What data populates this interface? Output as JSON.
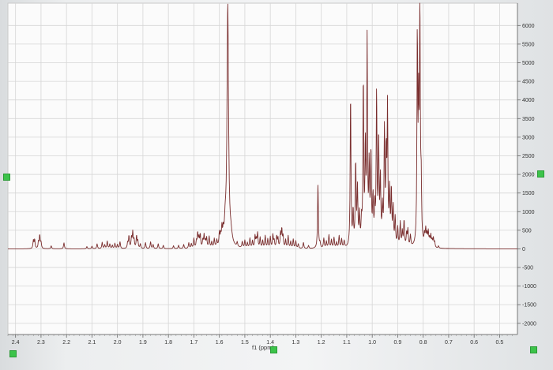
{
  "chart_data": {
    "type": "line",
    "title": "",
    "xlabel": "f1 (ppm)",
    "ylabel": "",
    "xlim": [
      2.43,
      0.43
    ],
    "xreversed": true,
    "ylim": [
      -2300,
      6600
    ],
    "xticks": [
      2.4,
      2.3,
      2.2,
      2.1,
      2.0,
      1.9,
      1.8,
      1.7,
      1.6,
      1.5,
      1.4,
      1.3,
      1.2,
      1.1,
      1.0,
      0.9,
      0.8,
      0.7,
      0.6,
      0.5
    ],
    "xtick_labels": [
      "2.4",
      "2.3",
      "2.2",
      "2.1",
      "2.0",
      "1.9",
      "1.8",
      "1.7",
      "1.6",
      "1.5",
      "1.4",
      "1.3",
      "1.2",
      "1.1",
      "1.0",
      "0.9",
      "0.8",
      "0.7",
      "0.6",
      "0.5"
    ],
    "yticks": [
      6000,
      5500,
      5000,
      4500,
      4000,
      3500,
      3000,
      2500,
      2000,
      1500,
      1000,
      500,
      0,
      -500,
      -1000,
      -1500,
      -2000
    ],
    "ytick_labels": [
      "6000",
      "5500",
      "5000",
      "4500",
      "4000",
      "3500",
      "3000",
      "2500",
      "2000",
      "1500",
      "1000",
      "500",
      "0",
      "-500",
      "-1000",
      "-1500",
      "-2000"
    ],
    "grid": true,
    "baseline": 0,
    "series": [
      {
        "color": "#7a2e2e",
        "peaks": [
          {
            "x": 2.33,
            "y": 220,
            "w": 0.002
          },
          {
            "x": 2.325,
            "y": 240,
            "w": 0.002
          },
          {
            "x": 2.31,
            "y": 170,
            "w": 0.002
          },
          {
            "x": 2.305,
            "y": 350,
            "w": 0.002
          },
          {
            "x": 2.3,
            "y": 160,
            "w": 0.002
          },
          {
            "x": 2.26,
            "y": 80,
            "w": 0.002
          },
          {
            "x": 2.21,
            "y": 160,
            "w": 0.002
          },
          {
            "x": 2.12,
            "y": 60,
            "w": 0.002
          },
          {
            "x": 2.1,
            "y": 70,
            "w": 0.002
          },
          {
            "x": 2.08,
            "y": 130,
            "w": 0.002
          },
          {
            "x": 2.06,
            "y": 170,
            "w": 0.002
          },
          {
            "x": 2.05,
            "y": 100,
            "w": 0.002
          },
          {
            "x": 2.04,
            "y": 200,
            "w": 0.002
          },
          {
            "x": 2.03,
            "y": 120,
            "w": 0.002
          },
          {
            "x": 2.02,
            "y": 90,
            "w": 0.002
          },
          {
            "x": 2.01,
            "y": 140,
            "w": 0.002
          },
          {
            "x": 2.0,
            "y": 110,
            "w": 0.002
          },
          {
            "x": 1.99,
            "y": 180,
            "w": 0.002
          },
          {
            "x": 1.96,
            "y": 150,
            "w": 0.002
          },
          {
            "x": 1.955,
            "y": 330,
            "w": 0.002
          },
          {
            "x": 1.945,
            "y": 280,
            "w": 0.002
          },
          {
            "x": 1.94,
            "y": 420,
            "w": 0.002
          },
          {
            "x": 1.935,
            "y": 220,
            "w": 0.002
          },
          {
            "x": 1.925,
            "y": 330,
            "w": 0.002
          },
          {
            "x": 1.92,
            "y": 190,
            "w": 0.002
          },
          {
            "x": 1.91,
            "y": 120,
            "w": 0.002
          },
          {
            "x": 1.89,
            "y": 160,
            "w": 0.002
          },
          {
            "x": 1.87,
            "y": 180,
            "w": 0.002
          },
          {
            "x": 1.86,
            "y": 110,
            "w": 0.002
          },
          {
            "x": 1.84,
            "y": 130,
            "w": 0.002
          },
          {
            "x": 1.82,
            "y": 90,
            "w": 0.002
          },
          {
            "x": 1.78,
            "y": 80,
            "w": 0.002
          },
          {
            "x": 1.76,
            "y": 90,
            "w": 0.002
          },
          {
            "x": 1.74,
            "y": 110,
            "w": 0.002
          },
          {
            "x": 1.72,
            "y": 150,
            "w": 0.002
          },
          {
            "x": 1.71,
            "y": 120,
            "w": 0.002
          },
          {
            "x": 1.7,
            "y": 260,
            "w": 0.002
          },
          {
            "x": 1.69,
            "y": 180,
            "w": 0.002
          },
          {
            "x": 1.685,
            "y": 390,
            "w": 0.002
          },
          {
            "x": 1.68,
            "y": 250,
            "w": 0.002
          },
          {
            "x": 1.675,
            "y": 350,
            "w": 0.002
          },
          {
            "x": 1.665,
            "y": 200,
            "w": 0.002
          },
          {
            "x": 1.66,
            "y": 330,
            "w": 0.002
          },
          {
            "x": 1.655,
            "y": 170,
            "w": 0.002
          },
          {
            "x": 1.65,
            "y": 260,
            "w": 0.002
          },
          {
            "x": 1.64,
            "y": 300,
            "w": 0.002
          },
          {
            "x": 1.63,
            "y": 150,
            "w": 0.002
          },
          {
            "x": 1.62,
            "y": 230,
            "w": 0.002
          },
          {
            "x": 1.61,
            "y": 180,
            "w": 0.002
          },
          {
            "x": 1.6,
            "y": 340,
            "w": 0.002
          },
          {
            "x": 1.595,
            "y": 250,
            "w": 0.002
          },
          {
            "x": 1.59,
            "y": 420,
            "w": 0.002
          },
          {
            "x": 1.585,
            "y": 300,
            "w": 0.002
          },
          {
            "x": 1.577,
            "y": 500,
            "w": 0.004
          },
          {
            "x": 1.567,
            "y": 6500,
            "w": 0.0035
          },
          {
            "x": 1.555,
            "y": 260,
            "w": 0.006
          },
          {
            "x": 1.53,
            "y": 120,
            "w": 0.002
          },
          {
            "x": 1.51,
            "y": 160,
            "w": 0.002
          },
          {
            "x": 1.5,
            "y": 200,
            "w": 0.002
          },
          {
            "x": 1.49,
            "y": 140,
            "w": 0.002
          },
          {
            "x": 1.48,
            "y": 260,
            "w": 0.002
          },
          {
            "x": 1.47,
            "y": 190,
            "w": 0.002
          },
          {
            "x": 1.46,
            "y": 320,
            "w": 0.002
          },
          {
            "x": 1.455,
            "y": 220,
            "w": 0.002
          },
          {
            "x": 1.45,
            "y": 390,
            "w": 0.002
          },
          {
            "x": 1.44,
            "y": 280,
            "w": 0.002
          },
          {
            "x": 1.43,
            "y": 200,
            "w": 0.002
          },
          {
            "x": 1.42,
            "y": 330,
            "w": 0.002
          },
          {
            "x": 1.41,
            "y": 240,
            "w": 0.002
          },
          {
            "x": 1.4,
            "y": 300,
            "w": 0.002
          },
          {
            "x": 1.39,
            "y": 350,
            "w": 0.002
          },
          {
            "x": 1.385,
            "y": 200,
            "w": 0.002
          },
          {
            "x": 1.375,
            "y": 310,
            "w": 0.002
          },
          {
            "x": 1.37,
            "y": 250,
            "w": 0.002
          },
          {
            "x": 1.36,
            "y": 380,
            "w": 0.002
          },
          {
            "x": 1.355,
            "y": 480,
            "w": 0.002
          },
          {
            "x": 1.35,
            "y": 300,
            "w": 0.002
          },
          {
            "x": 1.34,
            "y": 220,
            "w": 0.002
          },
          {
            "x": 1.33,
            "y": 330,
            "w": 0.002
          },
          {
            "x": 1.32,
            "y": 180,
            "w": 0.002
          },
          {
            "x": 1.31,
            "y": 240,
            "w": 0.002
          },
          {
            "x": 1.3,
            "y": 200,
            "w": 0.002
          },
          {
            "x": 1.29,
            "y": 120,
            "w": 0.002
          },
          {
            "x": 1.27,
            "y": 160,
            "w": 0.002
          },
          {
            "x": 1.25,
            "y": 80,
            "w": 0.002
          },
          {
            "x": 1.213,
            "y": 1750,
            "w": 0.0018
          },
          {
            "x": 1.205,
            "y": 130,
            "w": 0.002
          },
          {
            "x": 1.19,
            "y": 260,
            "w": 0.002
          },
          {
            "x": 1.18,
            "y": 180,
            "w": 0.002
          },
          {
            "x": 1.17,
            "y": 350,
            "w": 0.002
          },
          {
            "x": 1.16,
            "y": 220,
            "w": 0.002
          },
          {
            "x": 1.15,
            "y": 280,
            "w": 0.002
          },
          {
            "x": 1.14,
            "y": 150,
            "w": 0.002
          },
          {
            "x": 1.13,
            "y": 320,
            "w": 0.002
          },
          {
            "x": 1.12,
            "y": 230,
            "w": 0.002
          },
          {
            "x": 1.11,
            "y": 180,
            "w": 0.002
          },
          {
            "x": 1.085,
            "y": 4150,
            "w": 0.0018
          },
          {
            "x": 1.075,
            "y": 900,
            "w": 0.002
          },
          {
            "x": 1.065,
            "y": 2200,
            "w": 0.002
          },
          {
            "x": 1.058,
            "y": 1500,
            "w": 0.002
          },
          {
            "x": 1.05,
            "y": 800,
            "w": 0.002
          },
          {
            "x": 1.042,
            "y": 600,
            "w": 0.002
          },
          {
            "x": 1.035,
            "y": 4400,
            "w": 0.0018
          },
          {
            "x": 1.027,
            "y": 2500,
            "w": 0.002
          },
          {
            "x": 1.02,
            "y": 5400,
            "w": 0.0018
          },
          {
            "x": 1.012,
            "y": 2000,
            "w": 0.002
          },
          {
            "x": 1.005,
            "y": 2400,
            "w": 0.002
          },
          {
            "x": 0.997,
            "y": 1200,
            "w": 0.002
          },
          {
            "x": 0.99,
            "y": 900,
            "w": 0.002
          },
          {
            "x": 0.983,
            "y": 4050,
            "w": 0.0018
          },
          {
            "x": 0.975,
            "y": 2800,
            "w": 0.002
          },
          {
            "x": 0.968,
            "y": 1700,
            "w": 0.002
          },
          {
            "x": 0.96,
            "y": 900,
            "w": 0.002
          },
          {
            "x": 0.952,
            "y": 3050,
            "w": 0.002
          },
          {
            "x": 0.945,
            "y": 2300,
            "w": 0.002
          },
          {
            "x": 0.94,
            "y": 3550,
            "w": 0.0018
          },
          {
            "x": 0.932,
            "y": 1400,
            "w": 0.002
          },
          {
            "x": 0.925,
            "y": 1450,
            "w": 0.002
          },
          {
            "x": 0.918,
            "y": 1000,
            "w": 0.002
          },
          {
            "x": 0.91,
            "y": 750,
            "w": 0.002
          },
          {
            "x": 0.9,
            "y": 500,
            "w": 0.002
          },
          {
            "x": 0.89,
            "y": 650,
            "w": 0.002
          },
          {
            "x": 0.882,
            "y": 400,
            "w": 0.002
          },
          {
            "x": 0.875,
            "y": 700,
            "w": 0.002
          },
          {
            "x": 0.865,
            "y": 350,
            "w": 0.002
          },
          {
            "x": 0.86,
            "y": 450,
            "w": 0.002
          },
          {
            "x": 0.85,
            "y": 300,
            "w": 0.002
          },
          {
            "x": 0.823,
            "y": 5500,
            "w": 0.0018
          },
          {
            "x": 0.818,
            "y": 3300,
            "w": 0.0018
          },
          {
            "x": 0.813,
            "y": 6500,
            "w": 0.0018
          },
          {
            "x": 0.808,
            "y": 1500,
            "w": 0.002
          },
          {
            "x": 0.795,
            "y": 280,
            "w": 0.002
          },
          {
            "x": 0.79,
            "y": 420,
            "w": 0.002
          },
          {
            "x": 0.785,
            "y": 300,
            "w": 0.002
          },
          {
            "x": 0.78,
            "y": 380,
            "w": 0.002
          },
          {
            "x": 0.775,
            "y": 200,
            "w": 0.002
          },
          {
            "x": 0.77,
            "y": 300,
            "w": 0.002
          },
          {
            "x": 0.765,
            "y": 180,
            "w": 0.002
          },
          {
            "x": 0.76,
            "y": 240,
            "w": 0.002
          },
          {
            "x": 0.755,
            "y": 150,
            "w": 0.002
          },
          {
            "x": 0.74,
            "y": 60,
            "w": 0.002
          }
        ]
      }
    ]
  }
}
